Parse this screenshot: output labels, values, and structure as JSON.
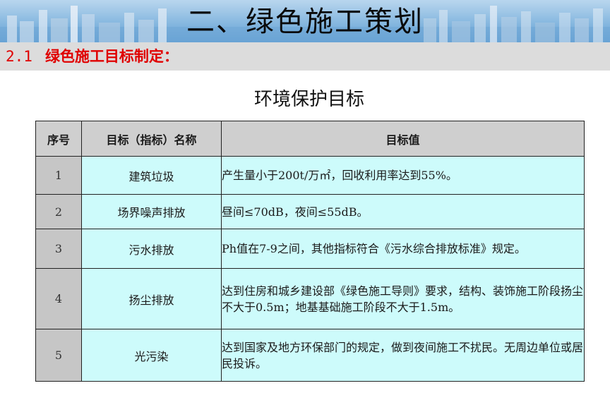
{
  "header": {
    "title": "二、绿色施工策划"
  },
  "section": {
    "number": "2.1",
    "title": "绿色施工目标制定："
  },
  "table": {
    "title": "环境保护目标",
    "columns": [
      "序号",
      "目标（指标）名称",
      "目标值"
    ],
    "rows": [
      {
        "num": "1",
        "name": "建筑垃圾",
        "value": "产生量小于200t/万㎡，回收利用率达到55%。"
      },
      {
        "num": "2",
        "name": "场界噪声排放",
        "value": "昼间≤70dB，夜间≤55dB。"
      },
      {
        "num": "3",
        "name": "污水排放",
        "value": "Ph值在7-9之间，其他指标符合《污水综合排放标准》规定。"
      },
      {
        "num": "4",
        "name": "扬尘排放",
        "value": "达到住房和城乡建设部《绿色施工导则》要求，结构、装饰施工阶段扬尘不大于0.5m；地基基础施工阶段不大于1.5m。"
      },
      {
        "num": "5",
        "name": "光污染",
        "value": "达到国家及地方环保部门的规定，做到夜间施工不扰民。无周边单位或居民投诉。"
      }
    ]
  },
  "colors": {
    "header_blue": "#8fbde2",
    "section_red": "#e00000",
    "cell_cyan": "#cdfbfb",
    "cell_gray": "#c6c6c6"
  }
}
